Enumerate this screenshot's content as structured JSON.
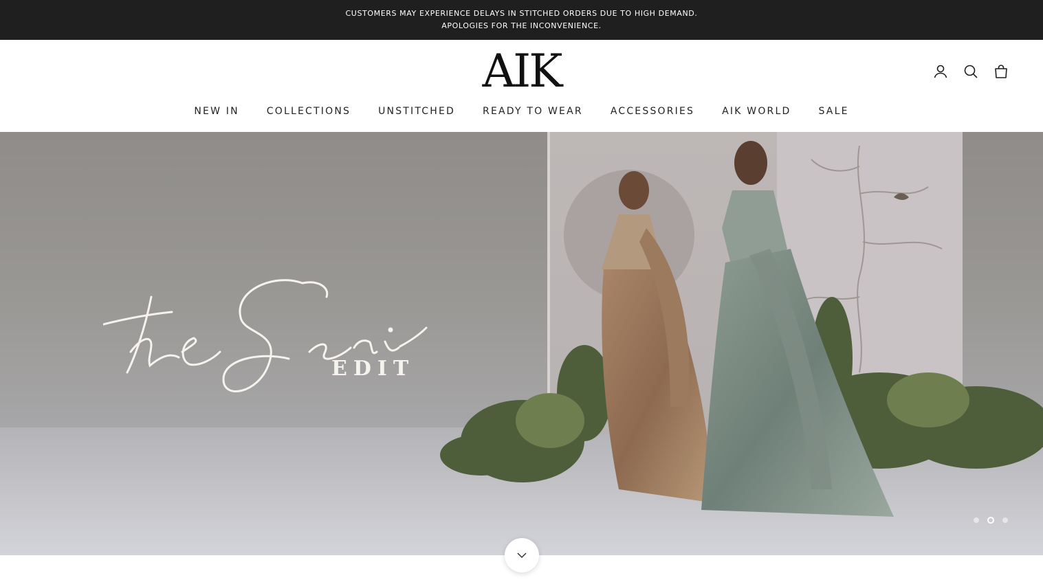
{
  "announcement": {
    "line1": "CUSTOMERS MAY EXPERIENCE DELAYS IN STITCHED ORDERS DUE TO HIGH DEMAND.",
    "line2": "APOLOGIES FOR THE INCONVENIENCE."
  },
  "header": {
    "logo": "AIK",
    "icons": [
      "account-icon",
      "search-icon",
      "cart-bag-icon"
    ]
  },
  "nav": {
    "items": [
      "NEW IN",
      "COLLECTIONS",
      "UNSTITCHED",
      "READY TO WEAR",
      "ACCESSORIES",
      "AIK WORLD",
      "SALE"
    ]
  },
  "hero": {
    "script_text": "theSari",
    "edit_text": "EDIT",
    "slide_count": 3,
    "active_slide": 2
  },
  "colors": {
    "announcement_bg": "#1f1f1f",
    "text_dark": "#1c1c1c",
    "hero_text": "#f6f3ee"
  }
}
